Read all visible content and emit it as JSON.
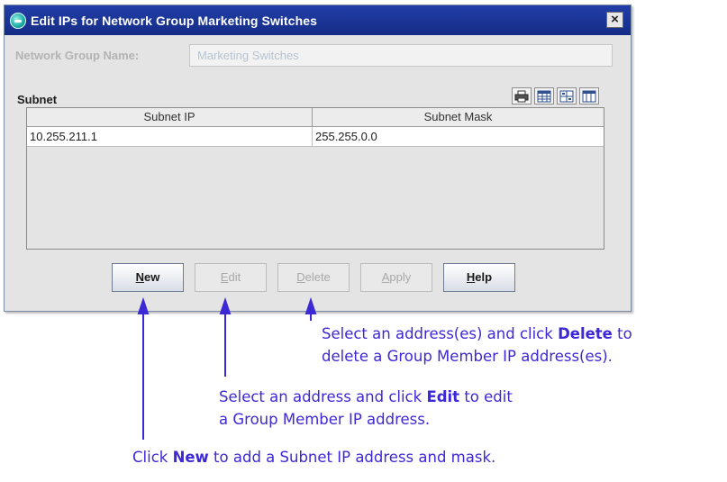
{
  "dialog": {
    "title": "Edit IPs for Network Group Marketing Switches",
    "close_glyph": "×",
    "field_label": "Network Group Name:",
    "field_value": "Marketing Switches",
    "section_label": "Subnet",
    "toolbar_icons": [
      "print-icon",
      "table-view-icon",
      "grid-view-icon",
      "column-view-icon"
    ]
  },
  "table": {
    "columns": [
      "Subnet IP",
      "Subnet Mask"
    ],
    "rows": [
      [
        "10.255.211.1",
        "255.255.0.0"
      ]
    ]
  },
  "buttons": [
    {
      "mnemonic": "N",
      "rest": "ew",
      "enabled": true
    },
    {
      "mnemonic": "E",
      "rest": "dit",
      "enabled": false
    },
    {
      "mnemonic": "D",
      "rest": "elete",
      "enabled": false
    },
    {
      "mnemonic": "A",
      "rest": "pply",
      "enabled": false
    },
    {
      "mnemonic": "H",
      "rest": "elp",
      "enabled": true
    }
  ],
  "annotations": {
    "delete_line1_a": "Select an address(es) and click ",
    "delete_line1_b": "Delete",
    "delete_line1_c": " to",
    "delete_line2": "delete a Group Member IP address(es).",
    "edit_line1_a": "Select an address and click ",
    "edit_line1_b": "Edit",
    "edit_line1_c": " to edit",
    "edit_line2": "a Group Member IP address.",
    "new_a": "Click ",
    "new_b": "New",
    "new_c": " to add a Subnet IP address and mask."
  },
  "colors": {
    "title_bar": "#1c36a0",
    "annotation": "#3d28d6",
    "dialog_bg": "#e4e4e4"
  }
}
